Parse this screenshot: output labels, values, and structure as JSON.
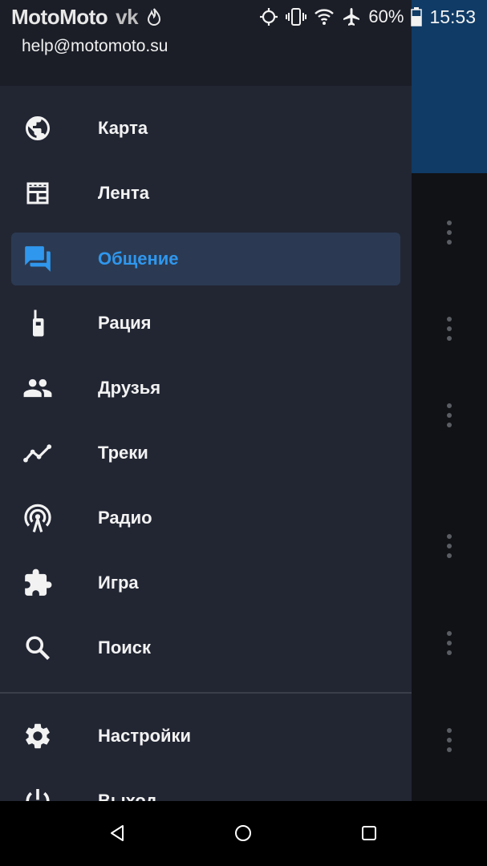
{
  "status_bar": {
    "left_text": "MotoMoto",
    "ghost_text": "vk",
    "battery": "60%",
    "time": "15:53"
  },
  "drawer": {
    "email": "help@motomoto.su",
    "items": [
      {
        "label": "Карта",
        "icon": "globe-icon",
        "active": false
      },
      {
        "label": "Лента",
        "icon": "newspaper-icon",
        "active": false
      },
      {
        "label": "Общение",
        "icon": "forum-icon",
        "active": true
      },
      {
        "label": "Рация",
        "icon": "walkie-talkie-icon",
        "active": false
      },
      {
        "label": "Друзья",
        "icon": "people-icon",
        "active": false
      },
      {
        "label": "Треки",
        "icon": "timeline-icon",
        "active": false
      },
      {
        "label": "Радио",
        "icon": "radio-tower-icon",
        "active": false
      },
      {
        "label": "Игра",
        "icon": "puzzle-icon",
        "active": false
      },
      {
        "label": "Поиск",
        "icon": "search-icon",
        "active": false
      }
    ],
    "bottom_items": [
      {
        "label": "Настройки",
        "icon": "gear-icon"
      },
      {
        "label": "Выход",
        "icon": "power-icon"
      }
    ]
  },
  "colors": {
    "drawer_bg": "#222633",
    "active_bg": "#2b3a52",
    "accent": "#2f97ee",
    "appbar": "#0f3b66"
  },
  "system_nav": {
    "back": "back-icon",
    "home": "home-icon",
    "recents": "recents-icon"
  }
}
